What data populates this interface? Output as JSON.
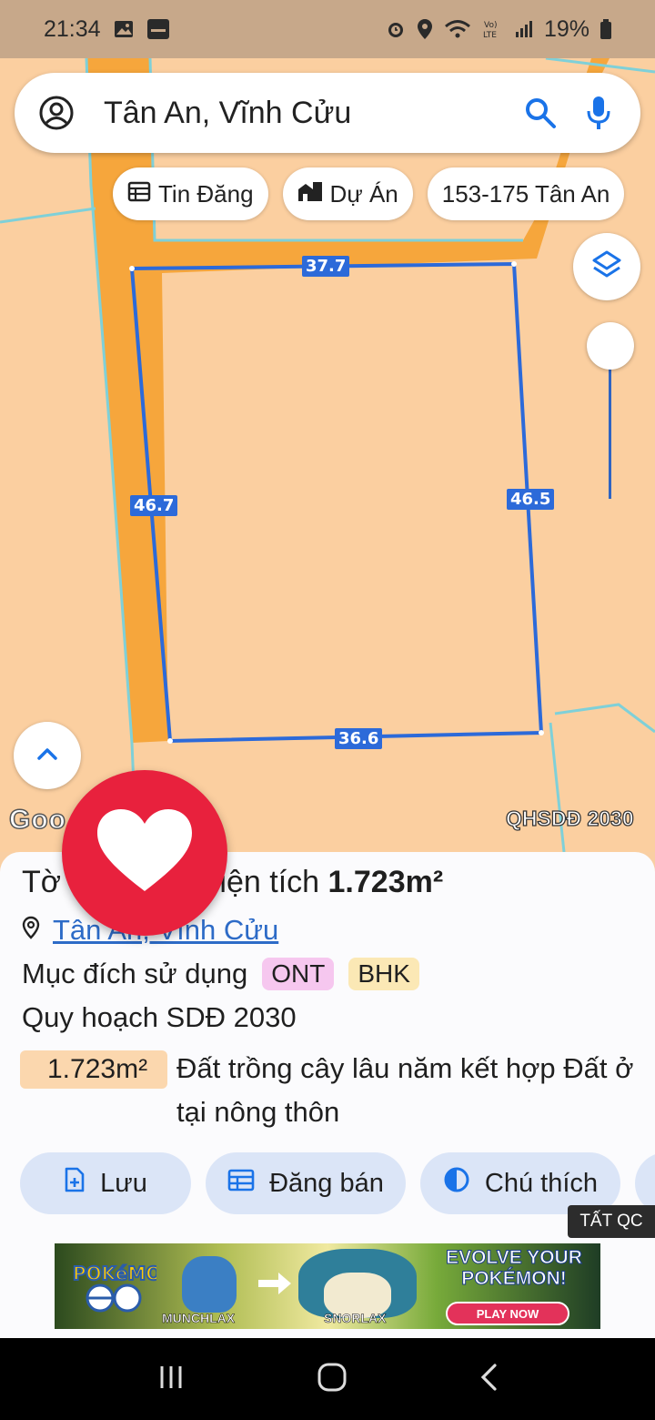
{
  "status_bar": {
    "time": "21:34",
    "battery": "19%"
  },
  "search": {
    "query": "Tân An, Vĩnh Cửu"
  },
  "chips": [
    {
      "label": "Tin Đăng",
      "icon": "calendar-icon"
    },
    {
      "label": "Dự Án",
      "icon": "buildings-icon"
    },
    {
      "label": "153-175 Tân An"
    }
  ],
  "map": {
    "dimensions": {
      "top": "37.7",
      "left": "46.7",
      "right": "46.5",
      "bottom": "36.6"
    },
    "google": "Goo",
    "overlay_label": "QHSDĐ 2030"
  },
  "parcel": {
    "title_prefix": "Tờ",
    "title_partial": "5, Diện tích",
    "area_bold": "1.723m²",
    "location": "Tân An, Vĩnh Cửu",
    "purpose_label": "Mục đích sử dụng",
    "purpose_tags": [
      "ONT",
      "BHK"
    ],
    "plan_label": "Quy hoạch SDĐ 2030",
    "plan_area": "1.723m²",
    "plan_desc": "Đất trồng cây lâu năm kết hợp Đất ở tại nông thôn"
  },
  "actions": [
    {
      "label": "Lưu",
      "icon": "add-file-icon"
    },
    {
      "label": "Đăng bán",
      "icon": "calendar-icon"
    },
    {
      "label": "Chú thích",
      "icon": "contrast-icon"
    }
  ],
  "ad": {
    "hide_label": "TẤT QC",
    "brand": "POKÉMON GO",
    "from": "MUNCHLAX",
    "to": "SNORLAX",
    "headline": "EVOLVE YOUR POKÉMON!",
    "cta": "PLAY NOW"
  },
  "colors": {
    "map_bg": "#fbcfa0",
    "road": "#f6a63c",
    "parcel_line": "#2c6ad9",
    "heart": "#e8213d",
    "chip_bg": "#dbe5f7"
  }
}
